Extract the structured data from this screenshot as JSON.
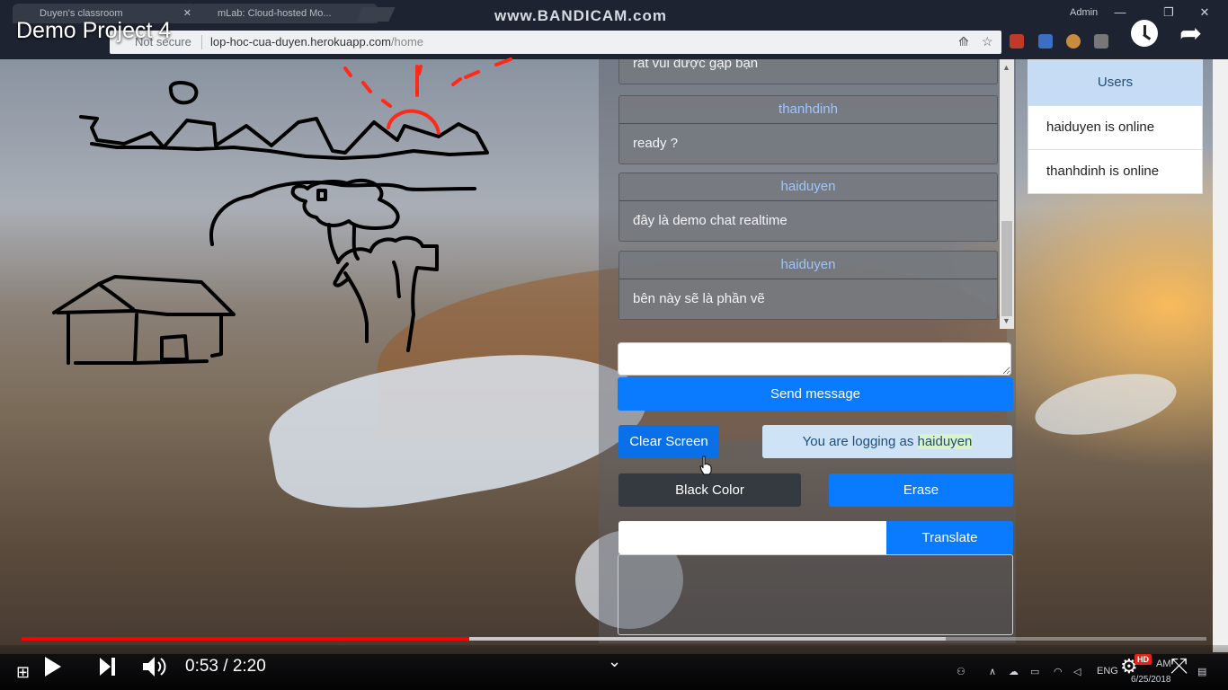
{
  "browser": {
    "tabs": [
      {
        "title": "Duyen's classroom"
      },
      {
        "title": "mLab: Cloud-hosted Mo..."
      }
    ],
    "watermark": "www.BANDICAM.com",
    "user_label": "Admin",
    "security_label": "Not secure",
    "url_host": "lop-hoc-cua-duyen.herokuapp.com",
    "url_path": "/home"
  },
  "video": {
    "title": "Demo Project 4",
    "current_time": "0:53",
    "duration": "2:20",
    "time_display": "0:53 / 2:20",
    "progress_fraction": 0.378,
    "buffered_fraction": 0.78,
    "hd_badge": "HD"
  },
  "chat": {
    "messages": [
      {
        "user": "",
        "text": "rất vui được gặp bạn"
      },
      {
        "user": "thanhdinh",
        "text": "ready ?"
      },
      {
        "user": "haiduyen",
        "text": "đây là demo chat realtime"
      },
      {
        "user": "haiduyen",
        "text": "bên này sẽ là phần vẽ"
      }
    ],
    "message_placeholder": "",
    "send_label": "Send message",
    "clear_label": "Clear Screen",
    "login_prefix": "You are logging as",
    "login_user": "haiduyen",
    "black_color_label": "Black Color",
    "erase_label": "Erase",
    "translate_label": "Translate"
  },
  "users": {
    "header": "Users",
    "list": [
      "haiduyen is online",
      "thanhdinh is online"
    ]
  },
  "taskbar": {
    "language": "ENG",
    "clock_time": "AM",
    "date": "6/25/2018"
  },
  "colors": {
    "primary": "#0a7bff",
    "dark": "#343a40",
    "username": "#9cc6ff",
    "progress": "#ff0000"
  }
}
